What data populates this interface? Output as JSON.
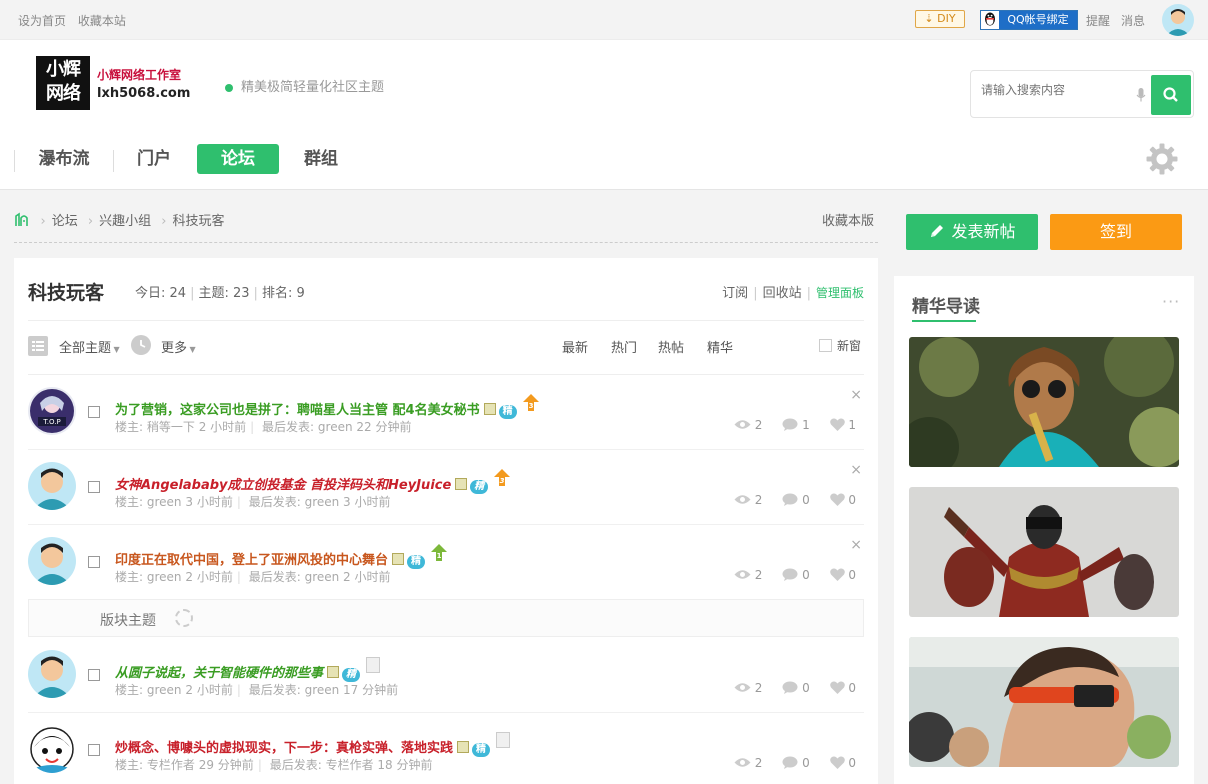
{
  "topbar": {
    "set_home": "设为首页",
    "bookmark": "收藏本站",
    "diy": "DIY",
    "qq_bind": "QQ帐号绑定",
    "remind": "提醒",
    "messages": "消息"
  },
  "header": {
    "logo_line1": "小辉",
    "logo_line2": "网络",
    "logo_name": "小辉网络工作室",
    "logo_domain": "lxh5068.com",
    "slogan": "精美极简轻量化社区主题",
    "search_placeholder": "请输入搜索内容"
  },
  "nav": {
    "items": [
      "瀑布流",
      "门户",
      "论坛",
      "群组"
    ],
    "active": "论坛"
  },
  "breadcrumb": {
    "items": [
      "论坛",
      "兴趣小组",
      "科技玩客"
    ],
    "favorite": "收藏本版"
  },
  "forum": {
    "name": "科技玩客",
    "today_label": "今日:",
    "today": "24",
    "topics_label": "主题:",
    "topics": "23",
    "rank_label": "排名:",
    "rank": "9",
    "subscribe": "订阅",
    "recycle": "回收站",
    "manage": "管理面板"
  },
  "filter": {
    "all": "全部主题",
    "more": "更多",
    "tabs": [
      "最新",
      "热门",
      "热帖",
      "精华"
    ],
    "new_window": "新窗"
  },
  "threads": [
    {
      "title": "为了营销，这家公司也是拼了：聘喵星人当主管 配4名美女秘书",
      "title_color": "#3a9d23",
      "italic": false,
      "author_label": "楼主:",
      "author": "稍等一下",
      "posted": "2 小时前",
      "last_label": "最后发表:",
      "last": "green 22 分钟前",
      "views": "2",
      "replies": "1",
      "likes": "1",
      "badge": "精",
      "up_level": "3"
    },
    {
      "title": "女神Angelababy成立创投基金 首投洋码头和HeyJuice",
      "title_color": "#c8202a",
      "italic": true,
      "author_label": "楼主:",
      "author": "green",
      "posted": "3 小时前",
      "last_label": "最后发表:",
      "last": "green 3 小时前",
      "views": "2",
      "replies": "0",
      "likes": "0",
      "badge": "精",
      "up_level": "3"
    },
    {
      "title": "印度正在取代中国，登上了亚洲风投的中心舞台",
      "title_color": "#c8571e",
      "italic": false,
      "author_label": "楼主:",
      "author": "green",
      "posted": "2 小时前",
      "last_label": "最后发表:",
      "last": "green 2 小时前",
      "views": "2",
      "replies": "0",
      "likes": "0",
      "badge": "精",
      "up_level": "1"
    },
    {
      "title": "从圆子说起，关于智能硬件的那些事",
      "title_color": "#3a9d23",
      "italic": true,
      "author_label": "楼主:",
      "author": "green",
      "posted": "2 小时前",
      "last_label": "最后发表:",
      "last": "green 17 分钟前",
      "views": "2",
      "replies": "0",
      "likes": "0",
      "badge": "精"
    },
    {
      "title": "炒概念、博噱头的虚拟现实，下一步：真枪实弹、落地实践",
      "title_color": "#c8202a",
      "italic": false,
      "author_label": "楼主:",
      "author": "专栏作者",
      "posted": "29 分钟前",
      "last_label": "最后发表:",
      "last": "专栏作者 18 分钟前",
      "views": "2",
      "replies": "0",
      "likes": "0",
      "badge": "精"
    }
  ],
  "section_row": "版块主题",
  "sidebar": {
    "post_button": "发表新帖",
    "sign_button": "签到",
    "digest_title": "精华导读",
    "more": "···"
  },
  "colors": {
    "accent_green": "#2fbf6e",
    "accent_orange": "#fb9a14"
  }
}
